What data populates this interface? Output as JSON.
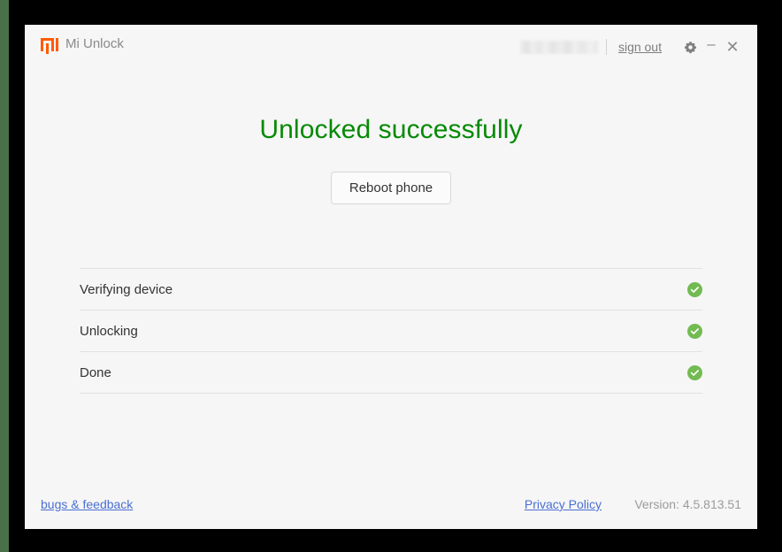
{
  "window": {
    "app_title": "Mi Unlock",
    "logo_icon": "mi-logo-icon",
    "logo_color": "#ff5b00"
  },
  "titlebar": {
    "account_name": "",
    "sign_out_label": "sign out",
    "settings_icon": "gear-icon",
    "minimize_icon": "minimize-icon",
    "minimize_glyph": "–",
    "close_icon": "close-icon",
    "close_glyph": "✕"
  },
  "main": {
    "status_heading": "Unlocked successfully",
    "status_color": "#058a05",
    "reboot_button_label": "Reboot phone"
  },
  "steps": [
    {
      "label": "Verifying device",
      "state": "complete",
      "icon": "check-circle-icon"
    },
    {
      "label": "Unlocking",
      "state": "complete",
      "icon": "check-circle-icon"
    },
    {
      "label": "Done",
      "state": "complete",
      "icon": "check-circle-icon"
    }
  ],
  "step_colors": {
    "complete": "#72bb53"
  },
  "footer": {
    "bugs_feedback_label": "bugs & feedback",
    "privacy_policy_label": "Privacy Policy",
    "version_label": "Version: 4.5.813.51",
    "link_color": "#4a6fd4"
  }
}
